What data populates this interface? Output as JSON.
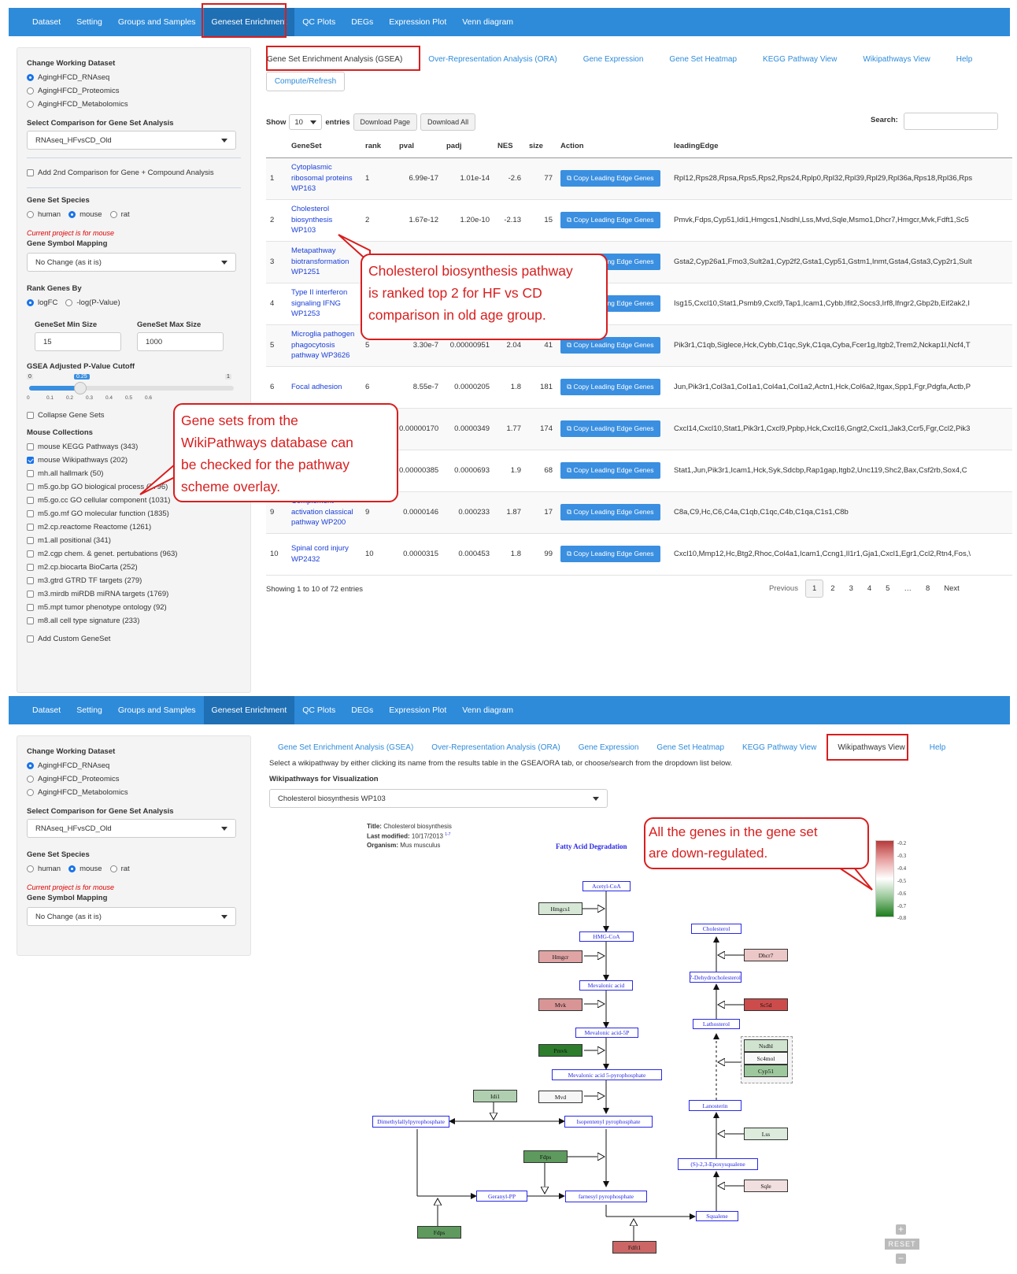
{
  "nav": [
    "Dataset",
    "Setting",
    "Groups and Samples",
    "Geneset Enrichment",
    "QC Plots",
    "DEGs",
    "Expression Plot",
    "Venn diagram"
  ],
  "sidebar": {
    "change_dataset_label": "Change Working Dataset",
    "datasets": [
      "AgingHFCD_RNAseq",
      "AgingHFCD_Proteomics",
      "AgingHFCD_Metabolomics"
    ],
    "comparison_label": "Select Comparison for Gene Set Analysis",
    "comparison_value": "RNAseq_HFvsCD_Old",
    "add_2nd": "Add 2nd Comparison for Gene + Compound Analysis",
    "species_label": "Gene Set Species",
    "species": [
      "human",
      "mouse",
      "rat"
    ],
    "current_project": "Current project is for mouse",
    "symbol_mapping_label": "Gene Symbol Mapping",
    "symbol_mapping_value": "No Change (as it is)",
    "rank_label": "Rank Genes By",
    "rank_options": [
      "logFC",
      "-log(P-Value)"
    ],
    "min_size_label": "GeneSet Min Size",
    "max_size_label": "GeneSet Max Size",
    "min_size": "15",
    "max_size": "1000",
    "cutoff_label": "GSEA Adjusted P-Value Cutoff",
    "cutoff_value": "0.25",
    "cutoff_min": "0",
    "cutoff_max": "1",
    "slider_ticks": [
      "0",
      "0.1",
      "0.2",
      "0.3",
      "0.4",
      "0.5",
      "0.6"
    ],
    "collapse": "Collapse Gene Sets",
    "collections_label": "Mouse Collections",
    "collections": [
      "mouse KEGG Pathways (343)",
      "mouse Wikipathways (202)",
      "mh.all hallmark (50)",
      "m5.go.bp GO biological process (7796)",
      "m5.go.cc GO cellular component (1031)",
      "m5.go.mf GO molecular function (1835)",
      "m2.cp.reactome Reactome (1261)",
      "m1.all positional (341)",
      "m2.cgp chem. & genet. pertubations (963)",
      "m2.cp.biocarta BioCarta (252)",
      "m3.gtrd GTRD TF targets (279)",
      "m3.mirdb miRDB miRNA targets (1769)",
      "m5.mpt tumor phenotype ontology (92)",
      "m8.all cell type signature (233)"
    ],
    "add_custom": "Add Custom GeneSet"
  },
  "tabs": [
    "Gene Set Enrichment Analysis (GSEA)",
    "Over-Representation Analysis (ORA)",
    "Gene Expression",
    "Gene Set Heatmap",
    "KEGG Pathway View",
    "Wikipathways View",
    "Help"
  ],
  "compute_button": "Compute/Refresh",
  "table_controls": {
    "show": "Show",
    "entries_value": "10",
    "entries": "entries",
    "download_page": "Download Page",
    "download_all": "Download All",
    "search": "Search:"
  },
  "table": {
    "headers": [
      "",
      "GeneSet",
      "rank",
      "pval",
      "padj",
      "NES",
      "size",
      "Action",
      "leadingEdge"
    ],
    "copy_label": "Copy Leading Edge Genes",
    "rows": [
      {
        "n": "1",
        "geneset": "Cytoplasmic ribosomal proteins WP163",
        "rank": "1",
        "pval": "6.99e-17",
        "padj": "1.01e-14",
        "nes": "-2.6",
        "size": "77",
        "edge": "Rpl12,Rps28,Rpsa,Rps5,Rps2,Rps24,Rplp0,Rpl32,Rpl39,Rpl29,Rpl36a,Rps18,Rpl36,Rps"
      },
      {
        "n": "2",
        "geneset": "Cholesterol biosynthesis WP103",
        "rank": "2",
        "pval": "1.67e-12",
        "padj": "1.20e-10",
        "nes": "-2.13",
        "size": "15",
        "edge": "Pmvk,Fdps,Cyp51,Idi1,Hmgcs1,Nsdhl,Lss,Mvd,Sqle,Msmo1,Dhcr7,Hmgcr,Mvk,Fdft1,Sc5"
      },
      {
        "n": "3",
        "geneset": "Metapathway biotransformation WP1251",
        "rank": "",
        "pval": "",
        "padj": "",
        "nes": "",
        "size": "",
        "edge": "Gsta2,Cyp26a1,Fmo3,Sult2a1,Cyp2f2,Gsta1,Cyp51,Gstm1,Inmt,Gsta4,Gsta3,Cyp2r1,Sult"
      },
      {
        "n": "4",
        "geneset": "Type II interferon signaling IFNG WP1253",
        "rank": "",
        "pval": "",
        "padj": "",
        "nes": "",
        "size": "",
        "edge": "Isg15,Cxcl10,Stat1,Psmb9,Cxcl9,Tap1,Icam1,Cybb,Ifit2,Socs3,Irf8,Ifngr2,Gbp2b,Eif2ak2,I"
      },
      {
        "n": "5",
        "geneset": "Microglia pathogen phagocytosis pathway WP3626",
        "rank": "5",
        "pval": "3.30e-7",
        "padj": "0.00000951",
        "nes": "2.04",
        "size": "41",
        "edge": "Pik3r1,C1qb,Siglece,Hck,Cybb,C1qc,Syk,C1qa,Cyba,Fcer1g,Itgb2,Trem2,Nckap1l,Ncf4,T"
      },
      {
        "n": "6",
        "geneset": "Focal adhesion",
        "rank": "6",
        "pval": "8.55e-7",
        "padj": "0.0000205",
        "nes": "1.8",
        "size": "181",
        "edge": "Jun,Pik3r1,Col3a1,Col1a1,Col4a1,Col1a2,Actn1,Hck,Col6a2,Itgax,Spp1,Fgr,Pdgfa,Actb,P"
      },
      {
        "n": "7",
        "geneset": "",
        "rank": "",
        "pval": "0.00000170",
        "padj": "0.0000349",
        "nes": "1.77",
        "size": "174",
        "edge": "Cxcl14,Cxcl10,Stat1,Pik3r1,Cxcl9,Ppbp,Hck,Cxcl16,Gngt2,Cxcl1,Jak3,Ccr5,Fgr,Ccl2,Pik3"
      },
      {
        "n": "8",
        "geneset": "",
        "rank": "",
        "pval": "0.00000385",
        "padj": "0.0000693",
        "nes": "1.9",
        "size": "68",
        "edge": "Stat1,Jun,Pik3r1,Icam1,Hck,Syk,Sdcbp,Rap1gap,Itgb2,Unc119,Shc2,Bax,Csf2rb,Sox4,C"
      },
      {
        "n": "9",
        "geneset": "Complement activation classical pathway WP200",
        "rank": "9",
        "pval": "0.0000146",
        "padj": "0.000233",
        "nes": "1.87",
        "size": "17",
        "edge": "C8a,C9,Hc,C6,C4a,C1qb,C1qc,C4b,C1qa,C1s1,C8b"
      },
      {
        "n": "10",
        "geneset": "Spinal cord injury WP2432",
        "rank": "10",
        "pval": "0.0000315",
        "padj": "0.000453",
        "nes": "1.8",
        "size": "99",
        "edge": "Cxcl10,Mmp12,Hc,Btg2,Rhoc,Col4a1,Icam1,Ccng1,Il1r1,Gja1,Cxcl1,Egr1,Ccl2,Rtn4,Fos,\\"
      }
    ],
    "info": "Showing 1 to 10 of 72 entries",
    "pager": [
      "Previous",
      "1",
      "2",
      "3",
      "4",
      "5",
      "…",
      "8",
      "Next"
    ]
  },
  "callouts": {
    "c1": [
      "Cholesterol biosynthesis pathway",
      "is ranked top 2 for HF vs CD",
      "comparison in old age group."
    ],
    "c2": [
      "Gene sets from the",
      "WikiPathways database can",
      "be checked for the pathway",
      "scheme overlay."
    ],
    "c3": [
      "All the genes in the gene set",
      "are down-regulated."
    ]
  },
  "wiki": {
    "instruction": "Select a wikipathway by either clicking its name from the results table in the GSEA/ORA tab, or choose/search from the dropdown list below.",
    "vis_label": "Wikipathways for Visualization",
    "vis_value": "Cholesterol biosynthesis WP103",
    "title_k": "Title:",
    "title_v": "Cholesterol biosynthesis",
    "modified_k": "Last modified:",
    "modified_v": "10/17/2013",
    "organism_k": "Organism:",
    "organism_v": "Mus musculus",
    "superscript": "1-7",
    "fatty": "Fatty Acid Degradation",
    "legend": [
      "-0.2",
      "-0.3",
      "-0.4",
      "-0.5",
      "-0.6",
      "-0.7",
      "-0.8"
    ],
    "metabolites": [
      "Acetyl-CoA",
      "HMG-CoA",
      "Mevalonic acid",
      "Mevalonic acid-5P",
      "Mevalonic acid 5-pyrophosphate",
      "Isopentenyl pyrophosphate",
      "Dimethylallylpyrophosphate",
      "Geranyl-PP",
      "farnesyl pyrophosphate",
      "Squalene",
      "(S)-2,3-Epoxysqualene",
      "Lanosterin",
      "Lathosterol",
      "7-Dehydrocholesterol",
      "Cholesterol"
    ],
    "genes": [
      "Hmgcs1",
      "Hmgcr",
      "Mvk",
      "Pmvk",
      "Mvd",
      "Idi1",
      "Fdps",
      "Fdps",
      "Fdft1",
      "Sqle",
      "Lss",
      "Nsdhl",
      "Sc4mol",
      "Cyp51",
      "Sc5d",
      "Dhcr7"
    ],
    "reset": "RESET"
  }
}
